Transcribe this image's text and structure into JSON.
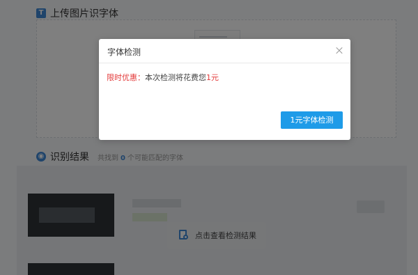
{
  "upload": {
    "title": "上传图片识字体",
    "icon": "upload-image-icon"
  },
  "results": {
    "title": "识别结果",
    "icon": "eye-icon",
    "count_prefix": "共找到",
    "count": "0",
    "count_suffix": "个可能匹配的字体",
    "view_button_label": "点击查看检测结果",
    "view_button_icon": "document-search-icon"
  },
  "modal": {
    "title": "字体检测",
    "promo_label": "限时优惠：",
    "message_text": "本次检测将花费您",
    "price": "1元",
    "confirm_label": "1元字体检测",
    "close_icon": "close-icon"
  },
  "colors": {
    "accent": "#1e9be8",
    "promo_red": "#e33b3b",
    "overlay": "rgba(0,0,0,0.5)"
  }
}
